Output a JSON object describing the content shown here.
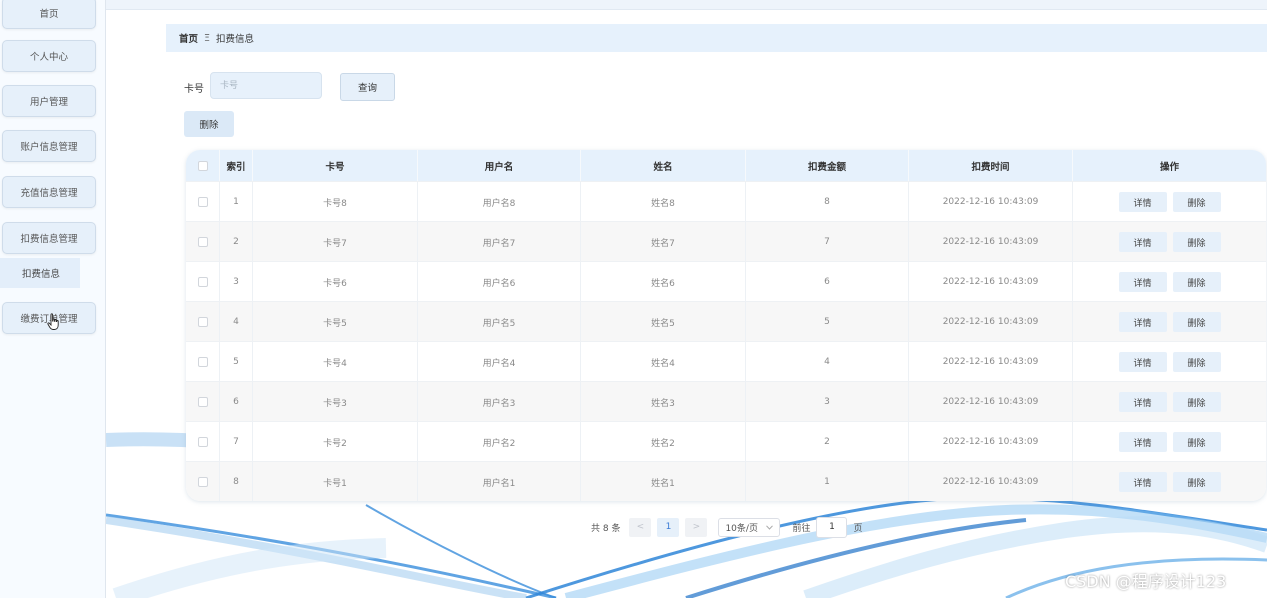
{
  "sidebar": {
    "items": [
      {
        "label": "首页"
      },
      {
        "label": "个人中心"
      },
      {
        "label": "用户管理"
      },
      {
        "label": "账户信息管理"
      },
      {
        "label": "充值信息管理"
      },
      {
        "label": "扣费信息管理"
      },
      {
        "label": "缴费订单管理"
      }
    ],
    "active_sub": "扣费信息"
  },
  "breadcrumb": {
    "home": "首页",
    "separator": "Ξ",
    "current": "扣费信息"
  },
  "search": {
    "label": "卡号",
    "placeholder": "卡号",
    "value": "",
    "button": "查询"
  },
  "actions": {
    "delete": "删除"
  },
  "table": {
    "columns": [
      "",
      "索引",
      "卡号",
      "用户名",
      "姓名",
      "扣费金额",
      "扣费时间",
      "操作"
    ],
    "rows": [
      {
        "index": "1",
        "card": "卡号8",
        "username": "用户名8",
        "name": "姓名8",
        "amount": "8",
        "time": "2022-12-16 10:43:09"
      },
      {
        "index": "2",
        "card": "卡号7",
        "username": "用户名7",
        "name": "姓名7",
        "amount": "7",
        "time": "2022-12-16 10:43:09"
      },
      {
        "index": "3",
        "card": "卡号6",
        "username": "用户名6",
        "name": "姓名6",
        "amount": "6",
        "time": "2022-12-16 10:43:09"
      },
      {
        "index": "4",
        "card": "卡号5",
        "username": "用户名5",
        "name": "姓名5",
        "amount": "5",
        "time": "2022-12-16 10:43:09"
      },
      {
        "index": "5",
        "card": "卡号4",
        "username": "用户名4",
        "name": "姓名4",
        "amount": "4",
        "time": "2022-12-16 10:43:09"
      },
      {
        "index": "6",
        "card": "卡号3",
        "username": "用户名3",
        "name": "姓名3",
        "amount": "3",
        "time": "2022-12-16 10:43:09"
      },
      {
        "index": "7",
        "card": "卡号2",
        "username": "用户名2",
        "name": "姓名2",
        "amount": "2",
        "time": "2022-12-16 10:43:09"
      },
      {
        "index": "8",
        "card": "卡号1",
        "username": "用户名1",
        "name": "姓名1",
        "amount": "1",
        "time": "2022-12-16 10:43:09"
      }
    ],
    "row_actions": {
      "detail": "详情",
      "delete": "删除"
    }
  },
  "pagination": {
    "total": "共 8 条",
    "prev": "<",
    "current_page": "1",
    "next": ">",
    "page_size": "10条/页",
    "goto_prefix": "前往",
    "goto_value": "1",
    "goto_suffix": "页"
  },
  "watermark": "CSDN @程序设计123",
  "colors": {
    "accent": "#e6f1fc",
    "button": "#e6f0fa",
    "wave": "#5fa8e8"
  }
}
